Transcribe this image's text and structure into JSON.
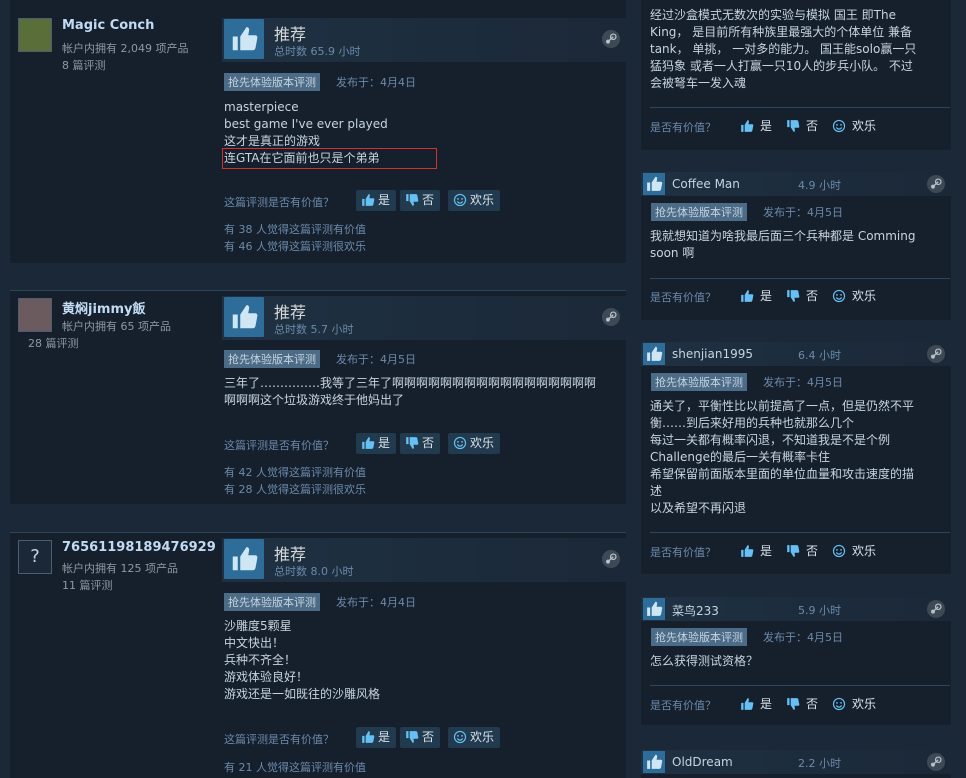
{
  "reviews": [
    {
      "author": "Magic Conch",
      "products": "帐户内拥有 2,049 项产品",
      "review_count": "8 篇评测",
      "recommendation": "推荐",
      "hours": "总时数 65.9 小时",
      "badge": "抢先体验版本评测",
      "posted": "发布于：4月4日",
      "lines": [
        "masterpiece",
        "best game I've ever played",
        "这才是真正的游戏",
        "连GTA在它面前也只是个弟弟"
      ],
      "helpful_q": "这篇评测是否有价值？",
      "stat1": "有 38 人觉得这篇评测有价值",
      "stat2": "有 46 人觉得这篇评测很欢乐"
    },
    {
      "author": "黄焖jimmy飯",
      "products": "帐户内拥有 65 项产品",
      "review_count": "28 篇评测",
      "recommendation": "推荐",
      "hours": "总时数 5.7 小时",
      "badge": "抢先体验版本评测",
      "posted": "发布于：4月5日",
      "lines": [
        "三年了……………我等了三年了啊啊啊啊啊啊啊啊啊啊啊啊啊啊啊啊啊",
        "啊啊啊这个垃圾游戏终于他妈出了"
      ],
      "helpful_q": "这篇评测是否有价值？",
      "stat1": "有 42 人觉得这篇评测有价值",
      "stat2": "有 28 人觉得这篇评测很欢乐"
    },
    {
      "author": "76561198189476929",
      "products": "帐户内拥有 125 项产品",
      "review_count": "11 篇评测",
      "recommendation": "推荐",
      "hours": "总时数 8.0 小时",
      "badge": "抢先体验版本评测",
      "posted": "发布于：4月4日",
      "lines": [
        "沙雕度5颗星",
        "中文快出！",
        "兵种不齐全！",
        "游戏体验良好！",
        "游戏还是一如既往的沙雕风格"
      ],
      "helpful_q": "这篇评测是否有价值？",
      "stat1": "有 21 人觉得这篇评测有价值",
      "stat2": ""
    }
  ],
  "vote_labels": {
    "yes": "是",
    "no": "否",
    "funny": "欢乐"
  },
  "right": {
    "top_text": [
      "经过沙盒模式无数次的实验与模拟 国王 即The",
      "King， 是目前所有种族里最强大的个体单位 兼备",
      "tank， 单挑， 一对多的能力。 国王能solo赢一只",
      "猛犸象 或者一人打赢一只10人的步兵小队。 不过",
      "会被弩车一发入魂"
    ],
    "helpful_q": "是否有价值？",
    "cards": [
      {
        "name": "Coffee Man",
        "hours": "4.9 小时",
        "badge": "抢先体验版本评测",
        "posted": "发布于：4月5日",
        "lines": [
          "我就想知道为啥我最后面三个兵种都是 Comming",
          "soon 啊"
        ]
      },
      {
        "name": "shenjian1995",
        "hours": "6.4 小时",
        "badge": "抢先体验版本评测",
        "posted": "发布于：4月5日",
        "lines": [
          "通关了，平衡性比以前提高了一点，但是仍然不平",
          "衡……到后来好用的兵种也就那么几个",
          "每过一关都有概率闪退，不知道我是不是个例",
          "Challenge的最后一关有概率卡住",
          "希望保留前面版本里面的单位血量和攻击速度的描",
          "述",
          "以及希望不再闪退"
        ]
      },
      {
        "name": "菜鸟233",
        "hours": "5.9 小时",
        "badge": "抢先体验版本评测",
        "posted": "发布于：4月5日",
        "lines": [
          "怎么获得测试资格？"
        ]
      },
      {
        "name": "OldDream",
        "hours": "2.2 小时"
      }
    ]
  },
  "colors": {
    "bg": "#1b2838",
    "accent": "#66c0f4",
    "thumb": "#2e6d9a",
    "highlight": "#d0312d"
  }
}
